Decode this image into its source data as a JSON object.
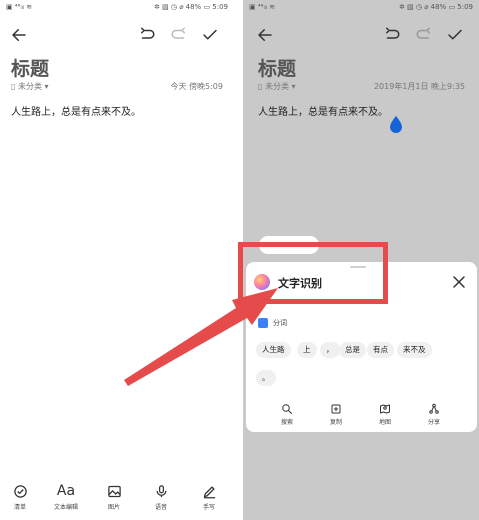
{
  "left_screen": {
    "status_left": "▣ ⁴⁶ᵢₗₗ ≋",
    "status_right": "✲ ▧ ◷ ⌀ 48% ▭ 5:09",
    "title": "标题",
    "category": "未分类 ▾",
    "date": "今天 傍晚5:09",
    "body": "人生路上，总是有点来不及。",
    "bottom_bar": [
      {
        "label": "清单",
        "glyph": ""
      },
      {
        "label": "文本编辑",
        "glyph": "Aa"
      },
      {
        "label": "图片",
        "glyph": ""
      },
      {
        "label": "语音",
        "glyph": ""
      },
      {
        "label": "手写",
        "glyph": ""
      }
    ]
  },
  "right_screen": {
    "status_left": "▣ ⁴⁶ᵢₗₗ ≋",
    "status_right": "✲ ▧ ◷ ⌀ 48% ▭ 5:09",
    "title": "标题",
    "category": "未分类 ▾",
    "date": "2019年1月1日 晚上9:35",
    "body": "人生路上，总是有点来不及。",
    "sheet": {
      "title": "文字识别",
      "segment_label": "分词",
      "chips": [
        "人生路",
        "上",
        "，",
        "总是",
        "有点",
        "来不及",
        "。"
      ],
      "actions": [
        {
          "label": "搜索",
          "icon": "search-icon"
        },
        {
          "label": "复制",
          "icon": "copy-icon"
        },
        {
          "label": "地图",
          "icon": "map-icon"
        },
        {
          "label": "分享",
          "icon": "share-icon"
        }
      ]
    }
  },
  "colors": {
    "accent_red": "#e54b4b",
    "drop_blue": "#1565d8",
    "dim_background": "#c9c9c9"
  }
}
